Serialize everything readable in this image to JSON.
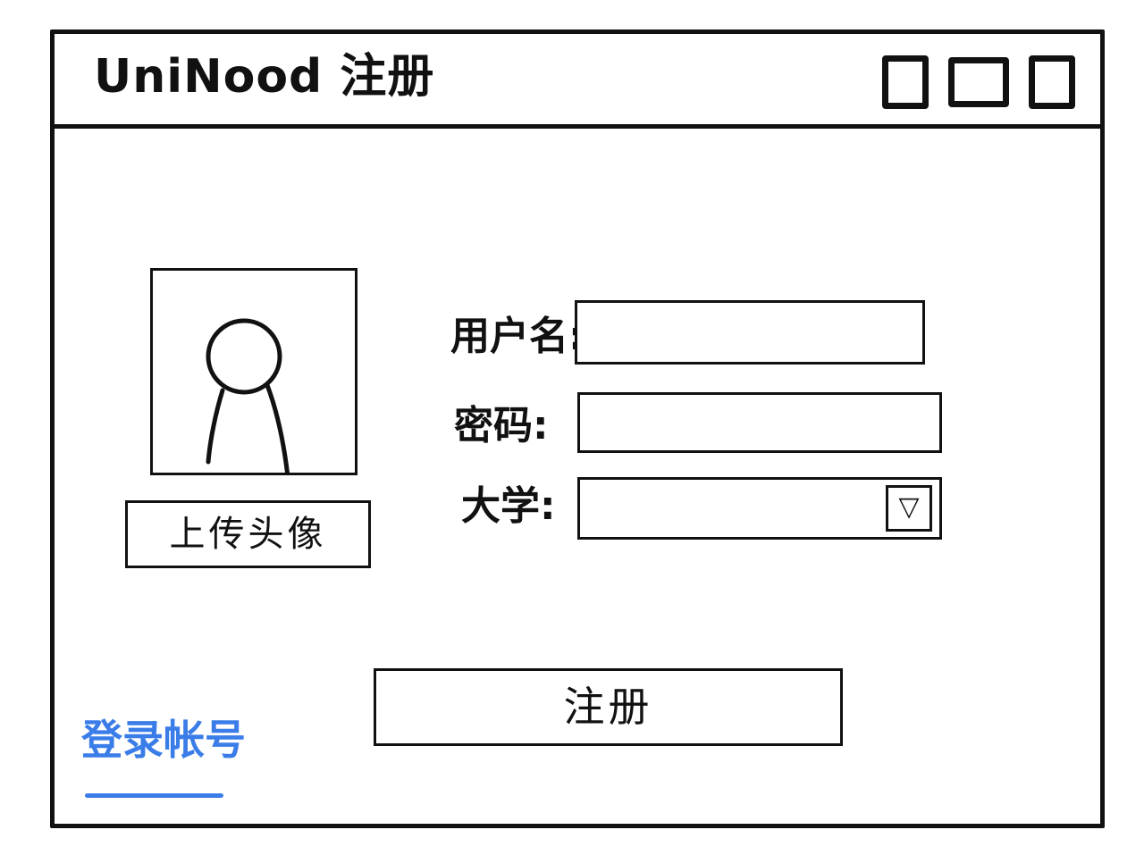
{
  "window": {
    "title": "UniNood 注册"
  },
  "avatar": {
    "upload_label": "上传头像"
  },
  "form": {
    "username": {
      "label": "用户名:",
      "value": ""
    },
    "password": {
      "label": "密码:",
      "value": ""
    },
    "university": {
      "label": "大学:",
      "selected": "",
      "arrow": "▽"
    }
  },
  "register": {
    "label": "注册"
  },
  "login_link": {
    "label": "登录帐号"
  },
  "colors": {
    "link": "#3b7de8",
    "ink": "#111111"
  }
}
